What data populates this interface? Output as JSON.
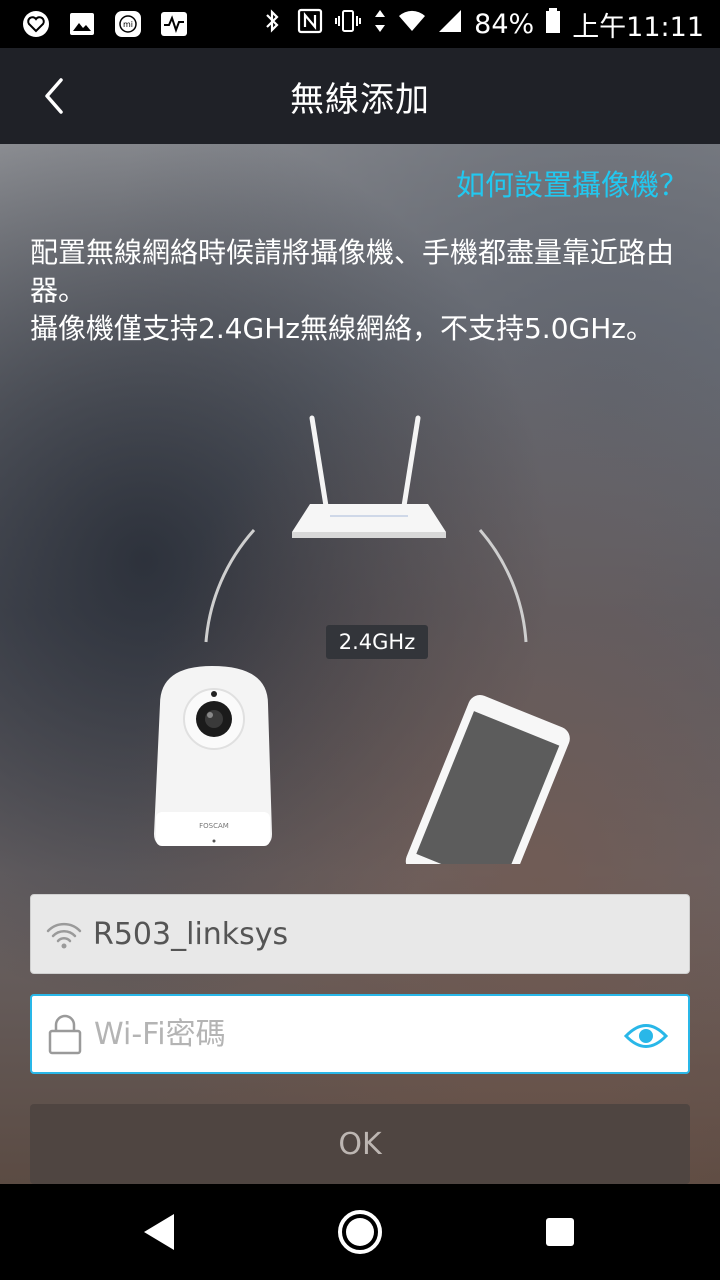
{
  "status_bar": {
    "battery": "84%",
    "time": "上午11:11",
    "left_icons": [
      "heart-app-icon",
      "gallery-icon",
      "mi-icon",
      "activity-icon"
    ],
    "right_icons": [
      "bluetooth-icon",
      "nfc-icon",
      "vibrate-icon",
      "data-arrows-icon",
      "wifi-icon",
      "signal-icon",
      "battery-icon"
    ]
  },
  "app_bar": {
    "title": "無線添加"
  },
  "main": {
    "help_link": "如何設置攝像機？",
    "description_line1": "配置無線網絡時候請將攝像機、手機都盡量靠近路由器。",
    "description_line2": "攝像機僅支持2.4GHz無線網絡，不支持5.0GHz。",
    "frequency_badge": "2.4GHz",
    "camera_brand": "FOSCAM"
  },
  "form": {
    "ssid_value": "R503_linksys",
    "password_placeholder": "Wi-Fi密碼",
    "password_value": "",
    "ok_label": "OK"
  },
  "colors": {
    "accent": "#29b7e8",
    "link": "#22c8f0",
    "app_bar": "#1f2127",
    "ok_button": "#4f4541"
  }
}
